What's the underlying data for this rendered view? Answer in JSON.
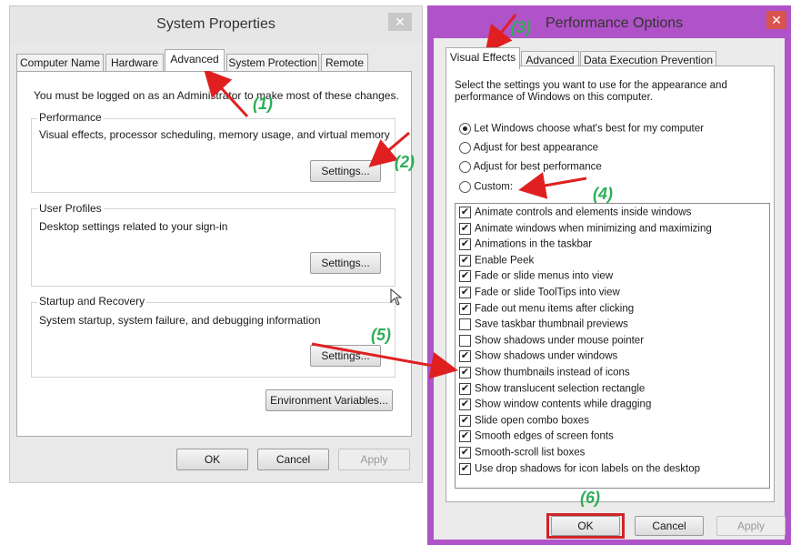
{
  "system_properties": {
    "title": "System Properties",
    "close_glyph": "✕",
    "tabs": [
      {
        "label": "Computer Name"
      },
      {
        "label": "Hardware"
      },
      {
        "label": "Advanced"
      },
      {
        "label": "System Protection"
      },
      {
        "label": "Remote"
      }
    ],
    "admin_note": "You must be logged on as an Administrator to make most of these changes.",
    "performance": {
      "title": "Performance",
      "desc": "Visual effects, processor scheduling, memory usage, and virtual memory",
      "button": "Settings..."
    },
    "user_profiles": {
      "title": "User Profiles",
      "desc": "Desktop settings related to your sign-in",
      "button": "Settings..."
    },
    "startup": {
      "title": "Startup and Recovery",
      "desc": "System startup, system failure, and debugging information",
      "button": "Settings..."
    },
    "env_button": "Environment Variables...",
    "ok": "OK",
    "cancel": "Cancel",
    "apply": "Apply"
  },
  "performance_options": {
    "title": "Performance Options",
    "close_glyph": "✕",
    "tabs": [
      {
        "label": "Visual Effects"
      },
      {
        "label": "Advanced"
      },
      {
        "label": "Data Execution Prevention"
      }
    ],
    "intro": "Select the settings you want to use for the appearance and performance of Windows on this computer.",
    "radios": [
      {
        "label": "Let Windows choose what's best for my computer",
        "selected": true
      },
      {
        "label": "Adjust for best appearance",
        "selected": false
      },
      {
        "label": "Adjust for best performance",
        "selected": false
      },
      {
        "label": "Custom:",
        "selected": false
      }
    ],
    "effects": [
      {
        "label": "Animate controls and elements inside windows",
        "checked": true
      },
      {
        "label": "Animate windows when minimizing and maximizing",
        "checked": true
      },
      {
        "label": "Animations in the taskbar",
        "checked": true
      },
      {
        "label": "Enable Peek",
        "checked": true
      },
      {
        "label": "Fade or slide menus into view",
        "checked": true
      },
      {
        "label": "Fade or slide ToolTips into view",
        "checked": true
      },
      {
        "label": "Fade out menu items after clicking",
        "checked": true
      },
      {
        "label": "Save taskbar thumbnail previews",
        "checked": false
      },
      {
        "label": "Show shadows under mouse pointer",
        "checked": false
      },
      {
        "label": "Show shadows under windows",
        "checked": true
      },
      {
        "label": "Show thumbnails instead of icons",
        "checked": true
      },
      {
        "label": "Show translucent selection rectangle",
        "checked": true
      },
      {
        "label": "Show window contents while dragging",
        "checked": true
      },
      {
        "label": "Slide open combo boxes",
        "checked": true
      },
      {
        "label": "Smooth edges of screen fonts",
        "checked": true
      },
      {
        "label": "Smooth-scroll list boxes",
        "checked": true
      },
      {
        "label": "Use drop shadows for icon labels on the desktop",
        "checked": true
      }
    ],
    "ok": "OK",
    "cancel": "Cancel",
    "apply": "Apply"
  },
  "annotations": {
    "step1": "(1)",
    "step2": "(2)",
    "step3": "(3)",
    "step4": "(4)",
    "step5": "(5)",
    "step6": "(6)",
    "arrow_color": "#e02020",
    "label_color": "#2fae58",
    "highlight_color": "#d0252a"
  }
}
